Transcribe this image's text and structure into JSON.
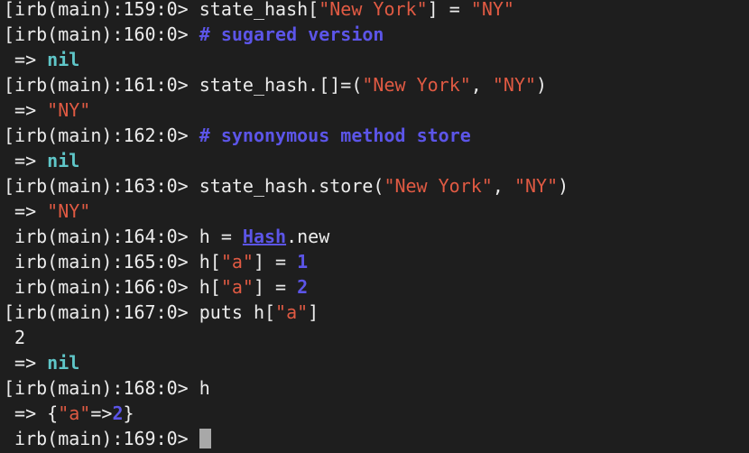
{
  "terminal": {
    "colors": {
      "background": "#1e1e1e",
      "text": "#ececec",
      "string": "#e05a43",
      "comment": "#5c55e8",
      "keyword": "#5fc6c8",
      "number": "#5c55e8",
      "cursor": "#a8a8a8"
    },
    "lines": [
      {
        "segments": [
          {
            "t": "[irb(main):159:0> state_hash[",
            "c": "plain"
          },
          {
            "t": "\"New York\"",
            "c": "str"
          },
          {
            "t": "] = ",
            "c": "plain"
          },
          {
            "t": "\"NY\"",
            "c": "str"
          }
        ]
      },
      {
        "segments": [
          {
            "t": "[irb(main):160:0> ",
            "c": "plain"
          },
          {
            "t": "# sugared version",
            "c": "comment"
          }
        ]
      },
      {
        "segments": [
          {
            "t": " => ",
            "c": "plain"
          },
          {
            "t": "nil",
            "c": "kw"
          }
        ]
      },
      {
        "segments": [
          {
            "t": "[irb(main):161:0> state_hash.[]=(",
            "c": "plain"
          },
          {
            "t": "\"New York\"",
            "c": "str"
          },
          {
            "t": ", ",
            "c": "plain"
          },
          {
            "t": "\"NY\"",
            "c": "str"
          },
          {
            "t": ")",
            "c": "plain"
          }
        ]
      },
      {
        "segments": [
          {
            "t": " => ",
            "c": "plain"
          },
          {
            "t": "\"NY\"",
            "c": "str"
          }
        ]
      },
      {
        "segments": [
          {
            "t": "[irb(main):162:0> ",
            "c": "plain"
          },
          {
            "t": "# synonymous method store",
            "c": "comment"
          }
        ]
      },
      {
        "segments": [
          {
            "t": " => ",
            "c": "plain"
          },
          {
            "t": "nil",
            "c": "kw"
          }
        ]
      },
      {
        "segments": [
          {
            "t": "[irb(main):163:0> state_hash.store(",
            "c": "plain"
          },
          {
            "t": "\"New York\"",
            "c": "str"
          },
          {
            "t": ", ",
            "c": "plain"
          },
          {
            "t": "\"NY\"",
            "c": "str"
          },
          {
            "t": ")",
            "c": "plain"
          }
        ]
      },
      {
        "segments": [
          {
            "t": " => ",
            "c": "plain"
          },
          {
            "t": "\"NY\"",
            "c": "str"
          }
        ]
      },
      {
        "segments": [
          {
            "t": " irb(main):164:0> h = ",
            "c": "plain"
          },
          {
            "t": "Hash",
            "c": "const"
          },
          {
            "t": ".new",
            "c": "plain"
          }
        ]
      },
      {
        "segments": [
          {
            "t": " irb(main):165:0> h[",
            "c": "plain"
          },
          {
            "t": "\"a\"",
            "c": "str"
          },
          {
            "t": "] = ",
            "c": "plain"
          },
          {
            "t": "1",
            "c": "num"
          }
        ]
      },
      {
        "segments": [
          {
            "t": " irb(main):166:0> h[",
            "c": "plain"
          },
          {
            "t": "\"a\"",
            "c": "str"
          },
          {
            "t": "] = ",
            "c": "plain"
          },
          {
            "t": "2",
            "c": "num"
          }
        ]
      },
      {
        "segments": [
          {
            "t": "[irb(main):167:0> puts h[",
            "c": "plain"
          },
          {
            "t": "\"a\"",
            "c": "str"
          },
          {
            "t": "]",
            "c": "plain"
          }
        ]
      },
      {
        "segments": [
          {
            "t": " 2",
            "c": "plain"
          }
        ]
      },
      {
        "segments": [
          {
            "t": " => ",
            "c": "plain"
          },
          {
            "t": "nil",
            "c": "kw"
          }
        ]
      },
      {
        "segments": [
          {
            "t": "[irb(main):168:0> h",
            "c": "plain"
          }
        ]
      },
      {
        "segments": [
          {
            "t": " => {",
            "c": "plain"
          },
          {
            "t": "\"a\"",
            "c": "str"
          },
          {
            "t": "=>",
            "c": "plain"
          },
          {
            "t": "2",
            "c": "num"
          },
          {
            "t": "}",
            "c": "plain"
          }
        ]
      },
      {
        "segments": [
          {
            "t": " irb(main):169:0> ",
            "c": "plain"
          }
        ],
        "cursor": true
      }
    ]
  }
}
